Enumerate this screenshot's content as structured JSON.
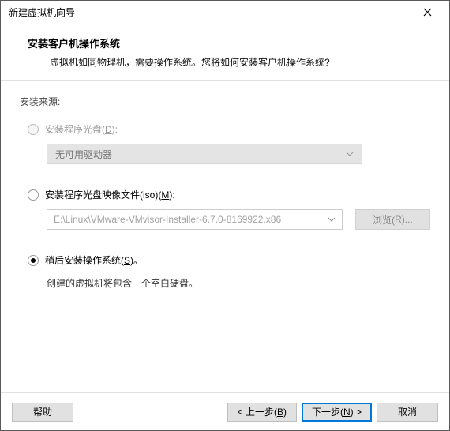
{
  "window": {
    "title": "新建虚拟机向导"
  },
  "header": {
    "title": "安装客户机操作系统",
    "desc": "虚拟机如同物理机，需要操作系统。您将如何安装客户机操作系统?"
  },
  "source": {
    "label": "安装来源:",
    "option_disc": {
      "label_pre": "安装程序光盘(",
      "key": "D",
      "label_post": "):"
    },
    "disc_dropdown": "无可用驱动器",
    "option_iso": {
      "label_pre": "安装程序光盘映像文件(iso)(",
      "key": "M",
      "label_post": "):"
    },
    "iso_value": "E:\\Linux\\VMware-VMvisor-Installer-6.7.0-8169922.x86",
    "browse": {
      "pre": "浏览(",
      "key": "R",
      "post": ")..."
    },
    "option_later": {
      "label_pre": "稍后安装操作系统(",
      "key": "S",
      "label_post": ")。"
    },
    "later_hint": "创建的虚拟机将包含一个空白硬盘。"
  },
  "footer": {
    "help": "帮助",
    "back": {
      "pre": "< 上一步(",
      "key": "B",
      "post": ")"
    },
    "next": {
      "pre": "下一步(",
      "key": "N",
      "post": ") >"
    },
    "cancel": "取消"
  }
}
